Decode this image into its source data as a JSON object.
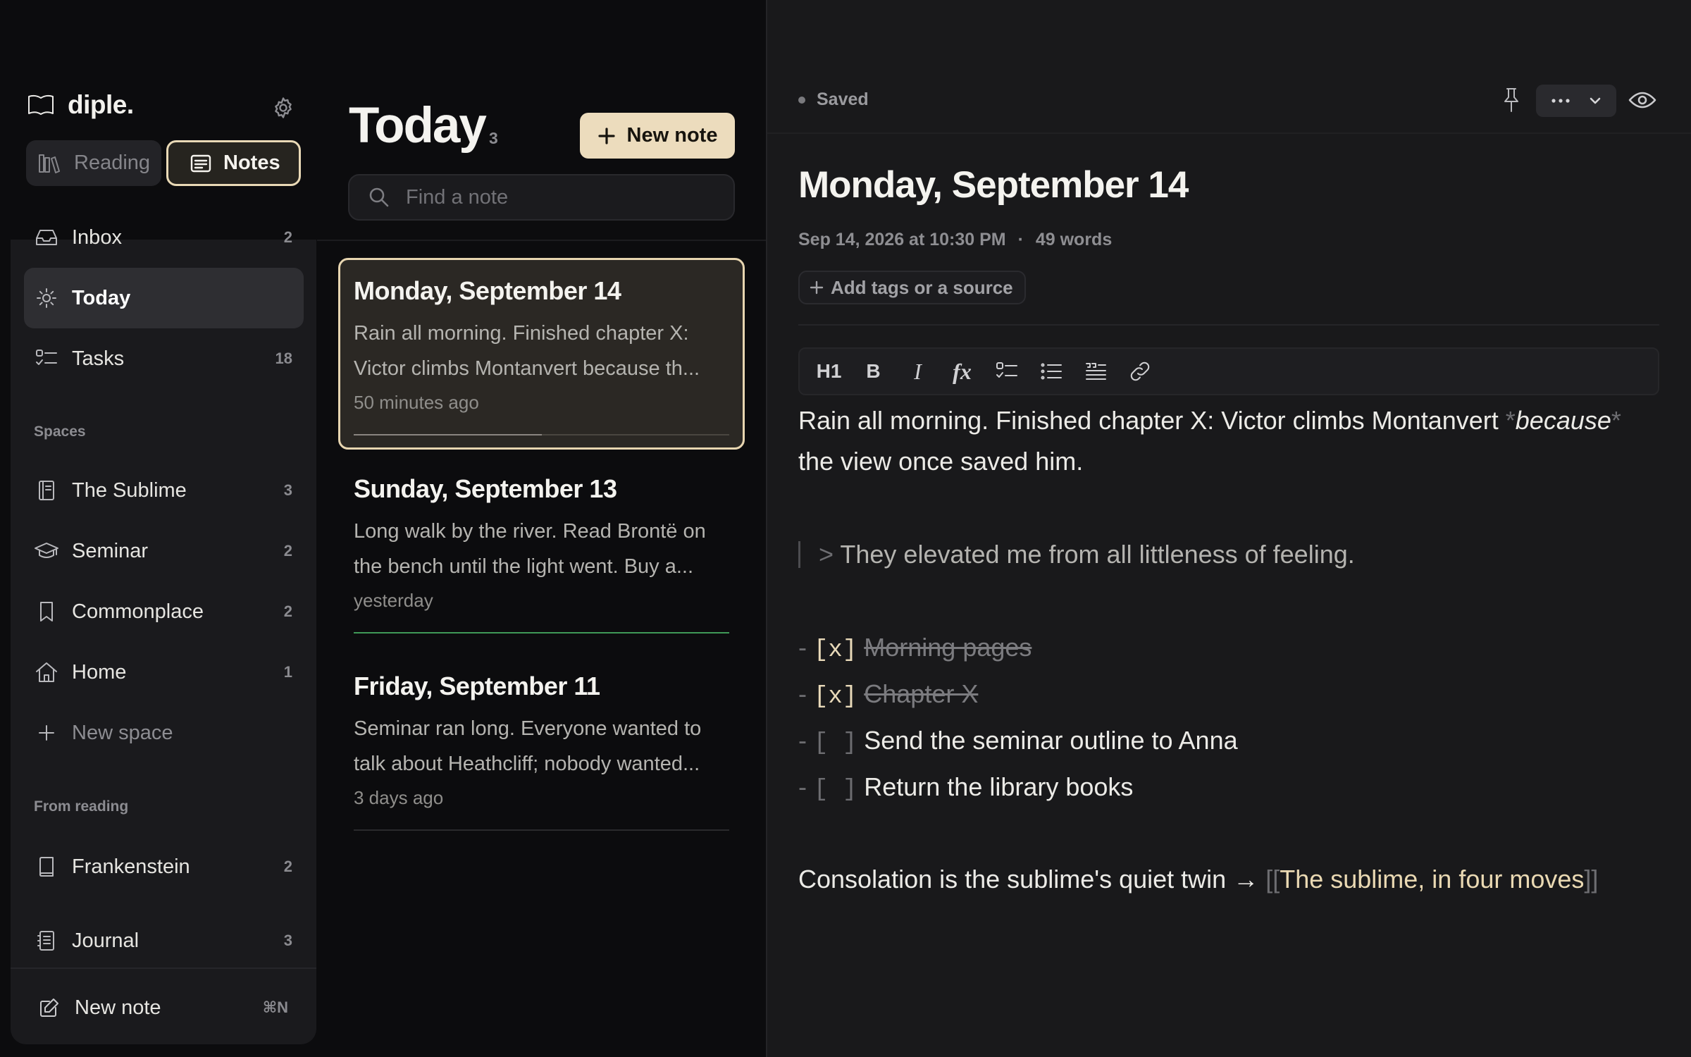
{
  "app": {
    "name": "diple."
  },
  "modes": {
    "reading": "Reading",
    "notes": "Notes"
  },
  "nav": [
    {
      "label": "Inbox",
      "count": "2",
      "icon": "inbox-icon"
    },
    {
      "label": "Today",
      "count": "",
      "icon": "sun-icon",
      "active": true
    },
    {
      "label": "Tasks",
      "count": "18",
      "icon": "tasks-icon"
    }
  ],
  "spaces": {
    "label": "Spaces",
    "items": [
      {
        "label": "The Sublime",
        "count": "3",
        "icon": "notebook-icon"
      },
      {
        "label": "Seminar",
        "count": "2",
        "icon": "graduation-cap-icon"
      },
      {
        "label": "Commonplace",
        "count": "2",
        "icon": "bookmark-icon"
      },
      {
        "label": "Home",
        "count": "1",
        "icon": "home-icon"
      }
    ],
    "new_space": "New space"
  },
  "from_reading": {
    "label": "From reading",
    "items": [
      {
        "label": "Frankenstein",
        "count": "2",
        "icon": "book-icon"
      },
      {
        "label": "Journal",
        "count": "3",
        "icon": "journal-icon"
      }
    ]
  },
  "sidebar_footer": {
    "new_note": "New note",
    "shortcut": "⌘N"
  },
  "list": {
    "title": "Today",
    "count": "3",
    "new_note": "New note",
    "search_placeholder": "Find a note",
    "notes": [
      {
        "title": "Monday, September 14",
        "preview_1": "Rain all morning. Finished chapter X:",
        "preview_2": "Victor climbs Montanvert because th...",
        "date": "50 minutes ago",
        "progress": 0.5,
        "accent": "#8a8580"
      },
      {
        "title": "Sunday, September 13",
        "preview_1": "Long walk by the river. Read Brontë on",
        "preview_2": "the bench until the light went. Buy a...",
        "date": "yesterday",
        "progress": 1.0,
        "accent": "#3f9a57"
      },
      {
        "title": "Friday, September 11",
        "preview_1": "Seminar ran long. Everyone wanted to",
        "preview_2": "talk about Heathcliff; nobody wanted...",
        "date": "3 days ago",
        "progress": 0,
        "accent": "#2a2a2d"
      }
    ]
  },
  "editor": {
    "status": "Saved",
    "title": "Monday, September 14",
    "meta": "Sep 14, 2026 at 10:30 PM",
    "meta_sep": "·",
    "words": "49 words",
    "add_tags": "Add tags or a source",
    "toolbar": {
      "h1": "H1",
      "bold": "B",
      "italic": "I",
      "fx": "fx"
    },
    "para1": {
      "line1_pre": "Rain all morning. Finished chapter X: Victor climbs Montanvert ",
      "star": "*",
      "italic": "because",
      "line2": "the view once saved him."
    },
    "quote": {
      "marker": ">",
      "text": "They elevated me from all littleness of feeling."
    },
    "tasks": [
      {
        "dash": "-",
        "box": "[x]",
        "text": "Morning pages",
        "done": true
      },
      {
        "dash": "-",
        "box": "[x]",
        "text": "Chapter X",
        "done": true
      },
      {
        "dash": "-",
        "box": "[ ]",
        "text": "Send the seminar outline to Anna",
        "done": false
      },
      {
        "dash": "-",
        "box": "[ ]",
        "text": "Return the library books",
        "done": false
      }
    ],
    "link_line": {
      "pre": "Consolation is the sublime's quiet twin → ",
      "open": "[[",
      "link": "The sublime, in four moves",
      "close": "]]"
    }
  },
  "colors": {
    "accent": "#ecdcbd",
    "background": "#0c0c0e",
    "panel": "#1a1a1d",
    "editor": "#19191b"
  }
}
